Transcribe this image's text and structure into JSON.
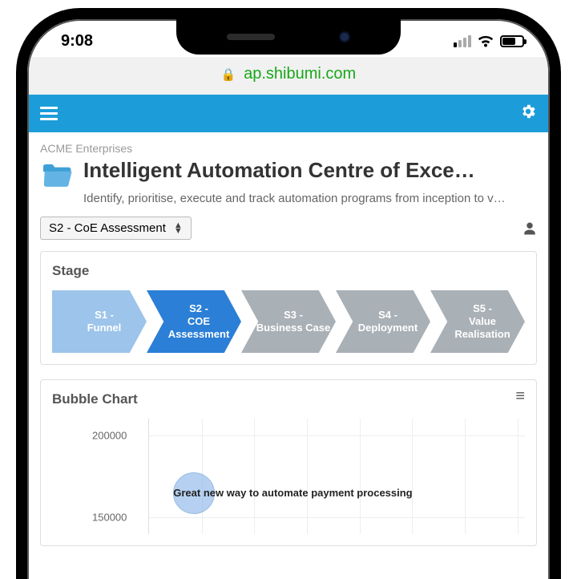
{
  "statusbar": {
    "time": "9:08"
  },
  "browser": {
    "url": "ap.shibumi.com"
  },
  "breadcrumb": "ACME Enterprises",
  "page_title": "Intelligent Automation Centre of Exce…",
  "subtitle": "Identify, prioritise, execute and track automation programs from inception to v…",
  "select": {
    "value": "S2 - CoE Assessment"
  },
  "stage_panel": {
    "title": "Stage"
  },
  "stages": [
    {
      "label": "S1 - Funnel",
      "color": "#9dc4ea",
      "active": false
    },
    {
      "label": "S2 - COE Assessment",
      "color": "#2b7fd6",
      "active": true
    },
    {
      "label": "S3 - Business Case",
      "color": "#a9b0b6",
      "active": false
    },
    {
      "label": "S4 - Deployment",
      "color": "#a9b0b6",
      "active": false
    },
    {
      "label": "S5 - Value Realisation",
      "color": "#a9b0b6",
      "active": false
    }
  ],
  "chart_panel": {
    "title": "Bubble Chart"
  },
  "chart_data": {
    "type": "bubble",
    "ylabel": "",
    "yticks": [
      200000,
      150000
    ],
    "ylim": [
      140000,
      210000
    ],
    "points": [
      {
        "label": "Great new way to automate payment processing",
        "y": 165000,
        "x_rel": 0.12,
        "r": 26
      }
    ]
  }
}
